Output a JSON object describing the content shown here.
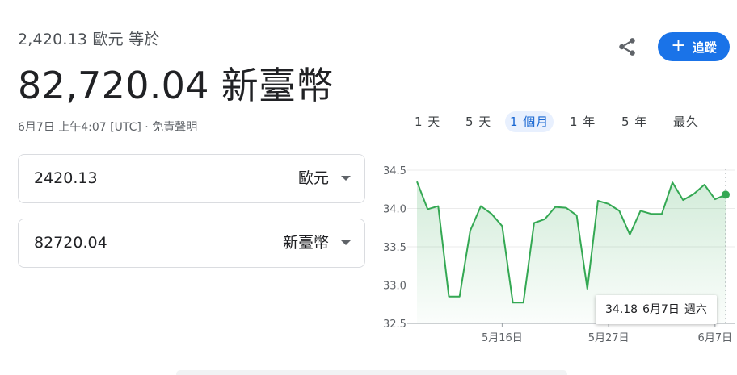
{
  "header": {
    "subtitle": "2,420.13 歐元 等於",
    "result": "82,720.04 新臺幣",
    "timestamp": "6月7日 上午4:07 [UTC]",
    "separator": " · ",
    "disclaimer": "免責聲明"
  },
  "actions": {
    "share_icon": "share-icon",
    "follow_label": "追蹤",
    "follow_icon": "+"
  },
  "converter": {
    "from": {
      "amount": "2420.13",
      "currency": "歐元"
    },
    "to": {
      "amount": "82720.04",
      "currency": "新臺幣"
    }
  },
  "range_tabs": {
    "items": [
      "1 天",
      "5 天",
      "1 個月",
      "1 年",
      "5 年",
      "最久"
    ],
    "active": "1 個月"
  },
  "tooltip": {
    "value": "34.18",
    "date": "6月7日",
    "weekday": "週六"
  },
  "colors": {
    "accent": "#1a73e8",
    "line": "#34a853",
    "fill": "#e6f4ea"
  },
  "chart_data": {
    "type": "line",
    "ylim": [
      32.5,
      34.5
    ],
    "y_ticks": [
      "34.5",
      "34.0",
      "33.5",
      "33.0",
      "32.5"
    ],
    "x_ticks": [
      "5月16日",
      "5月27日",
      "6月7日"
    ],
    "grid": true,
    "series": [
      {
        "values": [
          34.35,
          33.99,
          34.03,
          32.85,
          32.85,
          33.71,
          34.03,
          33.93,
          33.77,
          32.77,
          32.77,
          33.81,
          33.86,
          34.02,
          34.01,
          33.91,
          32.95,
          34.1,
          34.06,
          33.97,
          33.66,
          33.97,
          33.93,
          33.93,
          34.34,
          34.11,
          34.19,
          34.31,
          34.12,
          34.18
        ]
      }
    ]
  }
}
